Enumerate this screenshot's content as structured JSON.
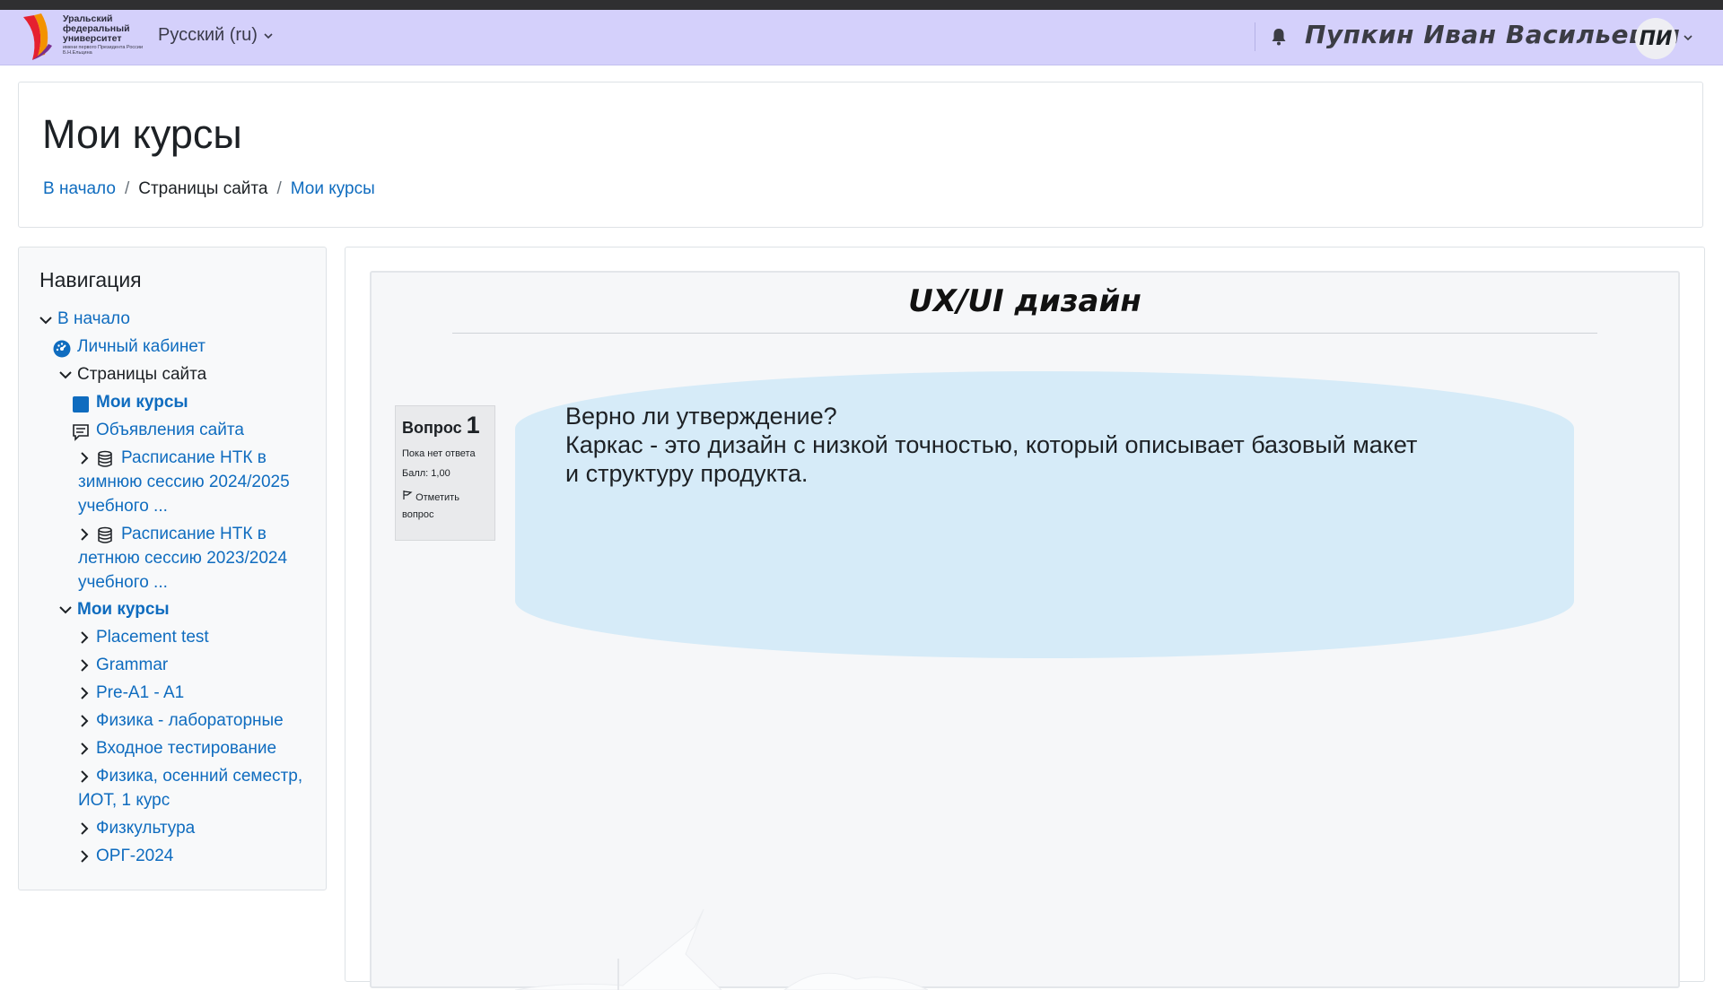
{
  "logo": {
    "lines": [
      "Уральский",
      "федеральный",
      "университет"
    ],
    "subtitle": "имени первого Президента России Б.Н.Ельцина",
    "colors": {
      "red": "#e5202f",
      "orange": "#f39200",
      "purple": "#7a2f8f"
    }
  },
  "header": {
    "language": "Русский (ru)",
    "user_name": "Пупкин Иван Васильевич",
    "avatar_initials": "ПИ",
    "icons": {
      "notifications": "bell-icon",
      "user_menu": "chevron-down-icon"
    }
  },
  "page": {
    "title": "Мои курсы",
    "breadcrumb": [
      {
        "label": "В начало",
        "link": true
      },
      {
        "label": "Страницы сайта",
        "link": false
      },
      {
        "label": "Мои курсы",
        "link": true
      }
    ]
  },
  "navigation": {
    "title": "Навигация",
    "home": "В начало",
    "dashboard": "Личный кабинет",
    "site_pages": "Страницы сайта",
    "my_courses_page": "Мои курсы",
    "site_announcements": "Объявления сайта",
    "schedule_winter": "Расписание НТК в зимнюю сессию 2024/2025 учебного ...",
    "schedule_summer": "Расписание НТК в летнюю сессию 2023/2024 учебного ...",
    "my_courses": "Мои курсы",
    "courses": [
      "Placement test",
      "Grammar",
      "Pre-A1 - A1",
      "Физика - лабораторные",
      "Входное тестирование",
      "Физика, осенний семестр, ИОТ, 1 курс",
      "Физкультура",
      "ОРГ-2024"
    ]
  },
  "slide": {
    "title": "UX/UI дизайн",
    "question": {
      "label": "Вопрос",
      "number": "1",
      "status": "Пока нет ответа",
      "grade": "Балл: 1,00",
      "flag": "Отметить вопрос",
      "text_line1": "Верно ли утверждение?",
      "text_line2": "Каркас - это дизайн с низкой точностью, который описывает базовый макет и структуру продукта."
    },
    "bubble_color": "#d6ebf8"
  },
  "colors": {
    "navbar": "#d4d0fb",
    "link": "#0f6cbf",
    "text": "#1d2125"
  }
}
